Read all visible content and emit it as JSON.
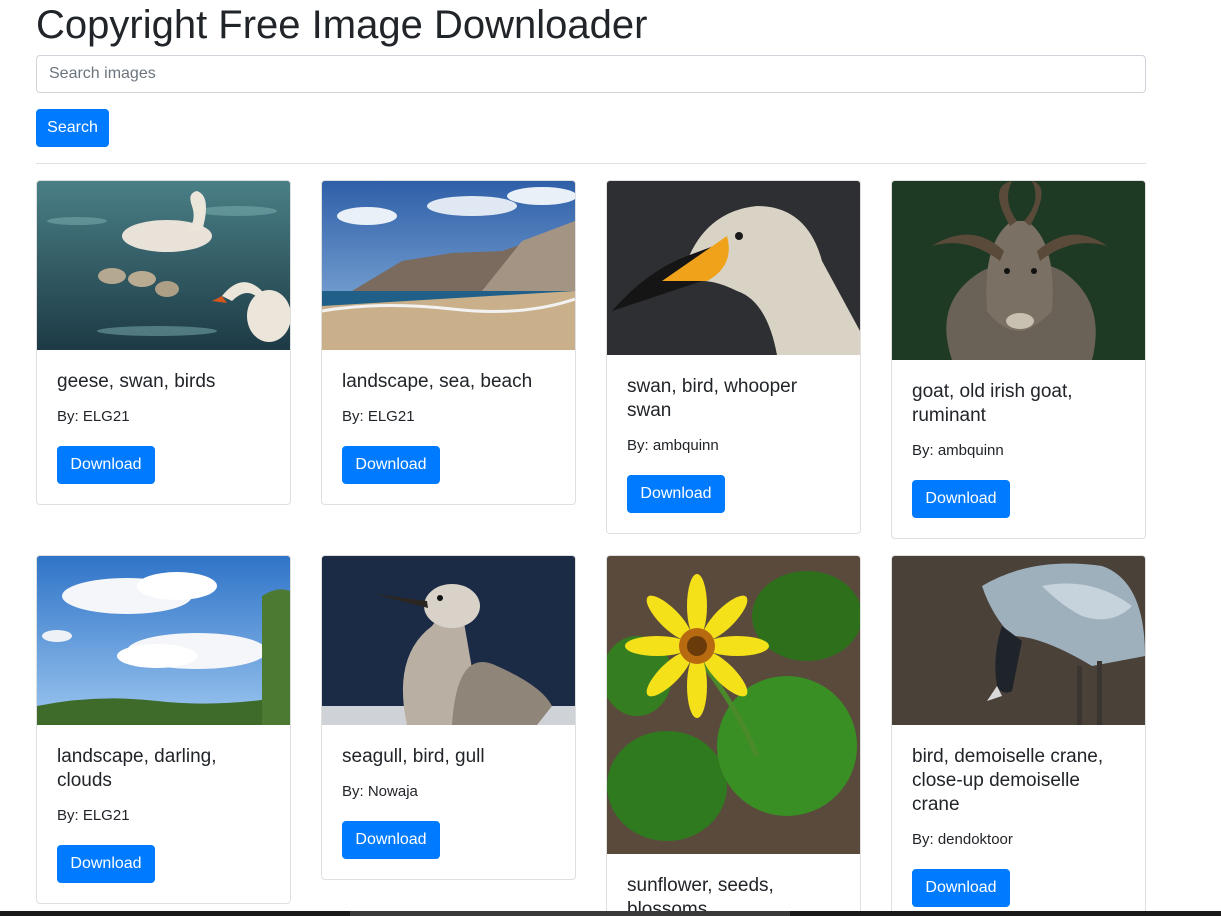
{
  "header": {
    "title": "Copyright Free Image Downloader"
  },
  "search": {
    "placeholder": "Search images",
    "value": "",
    "button_label": "Search"
  },
  "cards": [
    {
      "title": "geese, swan, birds",
      "author": "By: ELG21",
      "button_label": "Download",
      "image": "swans-with-goslings-photo"
    },
    {
      "title": "landscape, sea, beach",
      "author": "By: ELG21",
      "button_label": "Download",
      "image": "coastal-beach-photo"
    },
    {
      "title": "swan, bird, whooper swan",
      "author": "By: ambquinn",
      "button_label": "Download",
      "image": "whooper-swan-head-photo"
    },
    {
      "title": "goat, old irish goat, ruminant",
      "author": "By: ambquinn",
      "button_label": "Download",
      "image": "horned-goat-photo"
    },
    {
      "title": "landscape, darling, clouds",
      "author": "By: ELG21",
      "button_label": "Download",
      "image": "clouds-sky-photo"
    },
    {
      "title": "seagull, bird, gull",
      "author": "By: Nowaja",
      "button_label": "Download",
      "image": "seagull-photo"
    },
    {
      "title": "sunflower, seeds, blossoms",
      "author": "",
      "button_label": "",
      "image": "sunflower-photo"
    },
    {
      "title": "bird, demoiselle crane, close-up demoiselle crane",
      "author": "By: dendoktoor",
      "button_label": "Download",
      "image": "demoiselle-crane-photo"
    }
  ],
  "colors": {
    "primary": "#007bff",
    "text": "#212529",
    "border": "#dee2e6"
  }
}
